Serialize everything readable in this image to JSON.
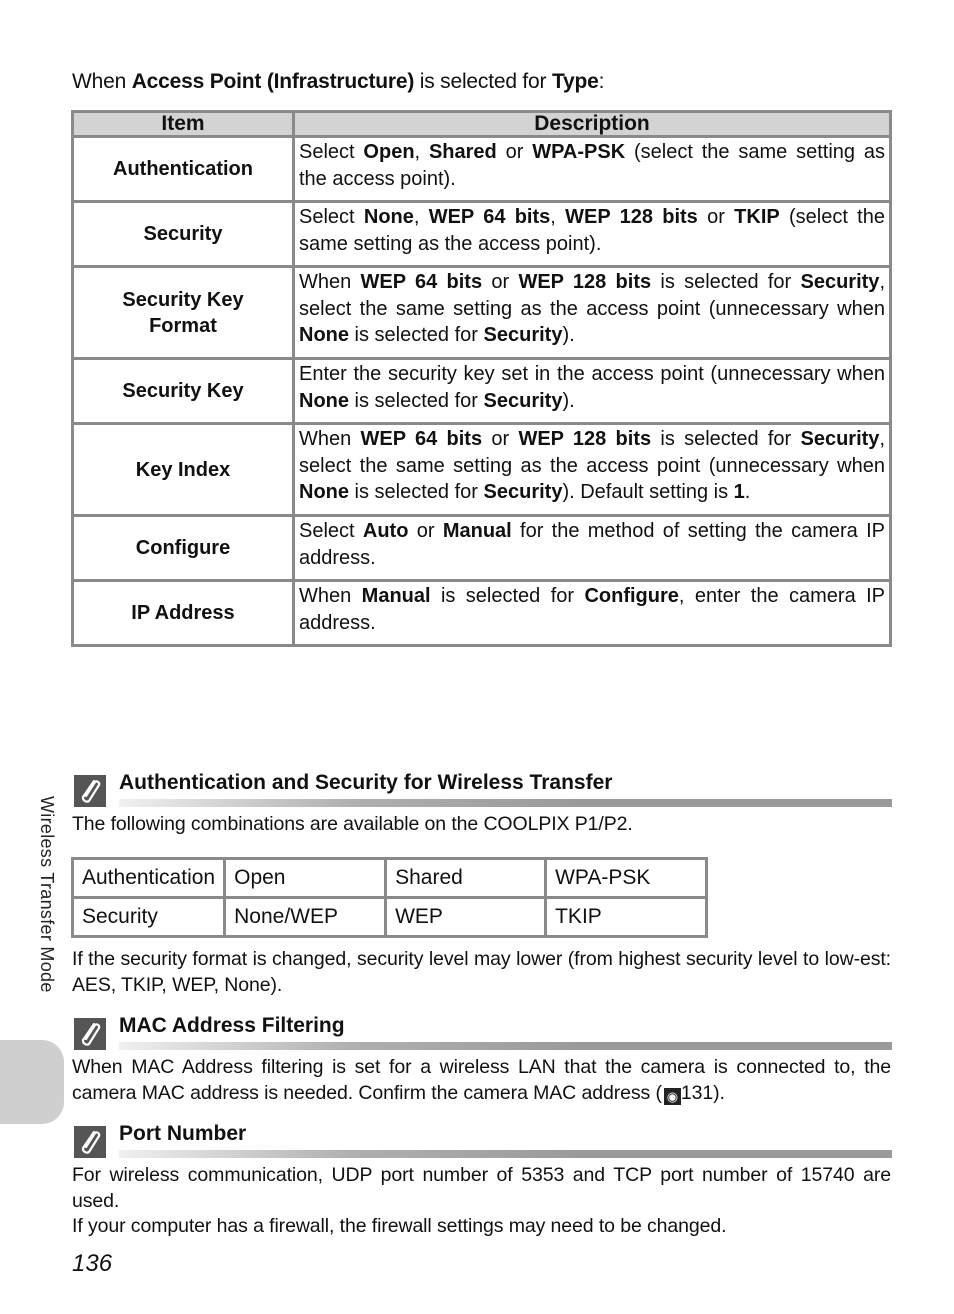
{
  "intro": {
    "prefix": "When ",
    "bold1": "Access Point (Infrastructure)",
    "middle": " is selected for ",
    "bold2": "Type",
    "suffix": ":"
  },
  "main_table": {
    "headers": [
      "Item",
      "Description"
    ],
    "rows": [
      {
        "item": "Authentication",
        "desc": [
          [
            "t",
            "Select "
          ],
          [
            "b",
            "Open"
          ],
          [
            "t",
            ", "
          ],
          [
            "b",
            "Shared"
          ],
          [
            "t",
            " or "
          ],
          [
            "b",
            "WPA-PSK"
          ],
          [
            "t",
            " (select the same setting as the access point)."
          ]
        ]
      },
      {
        "item": "Security",
        "desc": [
          [
            "t",
            "Select "
          ],
          [
            "b",
            "None"
          ],
          [
            "t",
            ", "
          ],
          [
            "b",
            "WEP 64 bits"
          ],
          [
            "t",
            ", "
          ],
          [
            "b",
            "WEP 128 bits"
          ],
          [
            "t",
            " or "
          ],
          [
            "b",
            "TKIP"
          ],
          [
            "t",
            " (select the same setting as the access point)."
          ]
        ]
      },
      {
        "item": "Security Key Format",
        "desc": [
          [
            "t",
            "When "
          ],
          [
            "b",
            "WEP 64 bits"
          ],
          [
            "t",
            " or "
          ],
          [
            "b",
            "WEP 128 bits"
          ],
          [
            "t",
            " is selected for "
          ],
          [
            "b",
            "Security"
          ],
          [
            "t",
            ", select the same setting as the access point (unnecessary when "
          ],
          [
            "b",
            "None"
          ],
          [
            "t",
            " is selected for "
          ],
          [
            "b",
            "Security"
          ],
          [
            "t",
            ")."
          ]
        ]
      },
      {
        "item": "Security Key",
        "desc": [
          [
            "t",
            "Enter the security key set in the access point (unnecessary when "
          ],
          [
            "b",
            "None"
          ],
          [
            "t",
            " is selected for "
          ],
          [
            "b",
            "Security"
          ],
          [
            "t",
            ")."
          ]
        ]
      },
      {
        "item": "Key Index",
        "desc": [
          [
            "t",
            "When "
          ],
          [
            "b",
            "WEP 64 bits"
          ],
          [
            "t",
            " or "
          ],
          [
            "b",
            "WEP 128 bits"
          ],
          [
            "t",
            " is selected for "
          ],
          [
            "b",
            "Security"
          ],
          [
            "t",
            ", select the same setting as the access point (unnecessary when "
          ],
          [
            "b",
            "None"
          ],
          [
            "t",
            " is selected for "
          ],
          [
            "b",
            "Security"
          ],
          [
            "t",
            "). Default setting is "
          ],
          [
            "b",
            "1"
          ],
          [
            "t",
            "."
          ]
        ]
      },
      {
        "item": "Configure",
        "desc": [
          [
            "t",
            "Select "
          ],
          [
            "b",
            "Auto"
          ],
          [
            "t",
            " or "
          ],
          [
            "b",
            "Manual"
          ],
          [
            "t",
            " for the method of setting the camera IP address."
          ]
        ]
      },
      {
        "item": "IP Address",
        "desc": [
          [
            "t",
            "When "
          ],
          [
            "b",
            "Manual"
          ],
          [
            "t",
            " is selected for "
          ],
          [
            "b",
            "Configure"
          ],
          [
            "t",
            ", enter the camera IP address."
          ]
        ]
      }
    ]
  },
  "notes": {
    "auth_security": {
      "icon": "paperclip-note-icon",
      "title": "Authentication and Security for Wireless Transfer",
      "intro": "The following combinations are available on the COOLPIX P1/P2.",
      "combo_table": [
        [
          "Authentication",
          "Open",
          "Shared",
          "WPA-PSK"
        ],
        [
          "Security",
          "None/WEP",
          "WEP",
          "TKIP"
        ]
      ],
      "footer": "If the security format is changed, security level may lower (from highest security level to low-est: AES, TKIP, WEP, None)."
    },
    "mac_filtering": {
      "icon": "paperclip-note-icon",
      "title": "MAC Address Filtering",
      "text_before": "When MAC Address filtering is set for a wireless LAN that the camera is connected to, the camera MAC address is needed. Confirm the camera MAC address (",
      "ref_icon": "page-reference-icon",
      "ref_page": "131",
      "text_after": ")."
    },
    "port_number": {
      "icon": "paperclip-note-icon",
      "title": "Port Number",
      "line1": "For wireless communication, UDP port number of 5353 and TCP port number of 15740 are used.",
      "line2": "If your computer has a firewall, the firewall settings may need to be changed."
    }
  },
  "side_label": "Wireless Transfer Mode",
  "page_number": "136"
}
